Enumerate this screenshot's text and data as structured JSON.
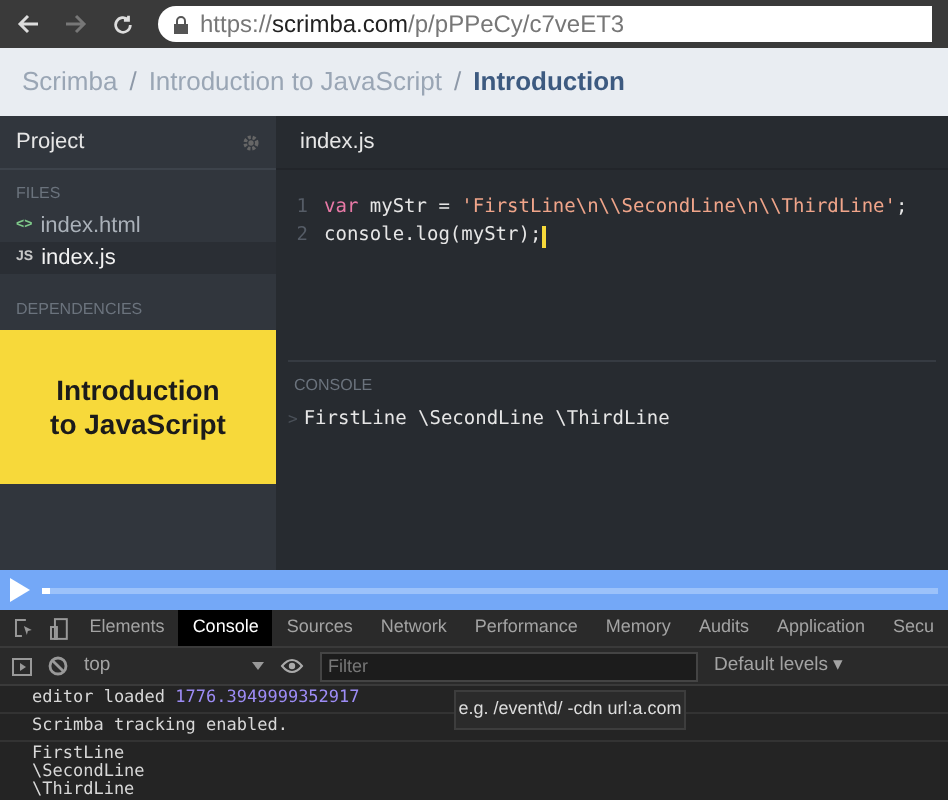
{
  "browser": {
    "url_prefix": "https://",
    "url_host": "scrimba.com",
    "url_path": "/p/pPPeCy/c7veET3"
  },
  "breadcrumb_separator": "/",
  "breadcrumb": [
    {
      "label": "Scrimba",
      "selected": false
    },
    {
      "label": "Introduction to JavaScript",
      "selected": false
    },
    {
      "label": "Introduction",
      "selected": true
    }
  ],
  "sidebar": {
    "title": "Project",
    "files_label": "FILES",
    "files": [
      {
        "name": "index.html",
        "icon": "<>",
        "selected": false
      },
      {
        "name": "index.js",
        "icon": "JS",
        "selected": true
      }
    ],
    "dependencies_label": "DEPENDENCIES",
    "course_card": {
      "title": "Introduction to JavaScript"
    }
  },
  "editor": {
    "tab": "index.js",
    "lines": [
      {
        "number": "1",
        "tokens": [
          {
            "kind": "keyword",
            "text": "var"
          },
          {
            "kind": "plain",
            "text": " myStr = "
          },
          {
            "kind": "string",
            "text": "'FirstLine\\n\\\\SecondLine\\n\\\\ThirdLine'"
          },
          {
            "kind": "plain",
            "text": ";"
          }
        ]
      },
      {
        "number": "2",
        "tokens": [
          {
            "kind": "plain",
            "text": "console.log(myStr);"
          }
        ],
        "cursor": true
      }
    ]
  },
  "console": {
    "label": "CONSOLE",
    "prompt": ">",
    "output": "FirstLine \\SecondLine \\ThirdLine"
  },
  "player": {
    "level": 0.01
  },
  "devtools": {
    "tabs": [
      {
        "label": "Elements",
        "selected": false
      },
      {
        "label": "Console",
        "selected": true
      },
      {
        "label": "Sources",
        "selected": false
      },
      {
        "label": "Network",
        "selected": false
      },
      {
        "label": "Performance",
        "selected": false
      },
      {
        "label": "Memory",
        "selected": false
      },
      {
        "label": "Audits",
        "selected": false
      },
      {
        "label": "Application",
        "selected": false
      },
      {
        "label": "Secu",
        "selected": false
      }
    ],
    "context": "top",
    "filter_placeholder": "Filter",
    "levels": "Default levels ▾",
    "logs": [
      {
        "tokens": [
          {
            "kind": "plain",
            "text": "editor loaded "
          },
          {
            "kind": "number",
            "text": "1776.3949999352917"
          }
        ]
      },
      {
        "tokens": [
          {
            "kind": "plain",
            "text": "Scrimba tracking enabled."
          }
        ]
      },
      {
        "tokens": [
          {
            "kind": "plain",
            "text": "FirstLine\n\\SecondLine\n\\ThirdLine"
          }
        ]
      }
    ],
    "tooltip": "e.g. /event\\d/ -cdn url:a.com"
  }
}
